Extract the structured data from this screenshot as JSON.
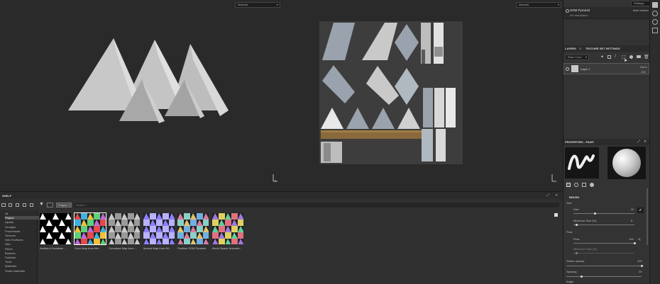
{
  "viewport": {
    "left_mode": "Material",
    "right_mode": "Material",
    "axis_label": "z"
  },
  "top": {
    "settings_label": "Settings"
  },
  "texture_set": {
    "name": "SOM Pyramid",
    "shader": "Main shader",
    "description": "No description"
  },
  "layers": {
    "tab_layers": "LAYERS",
    "tab_settings": "TEXTURE SET SETTINGS",
    "channel": "Base Color",
    "layer_name": "Layer 1",
    "blend_mode": "Norm",
    "opacity": "100"
  },
  "properties": {
    "title": "PROPERTIES - PAINT",
    "brush_header": "BRUSH",
    "size_label": "Size",
    "size_sub": "Size",
    "size_value": "20",
    "min_size_label": "Minimum Size (%)",
    "min_size_value": "5",
    "flow_header": "Flow",
    "flow_label": "Flow",
    "flow_value": "100",
    "min_flow_label": "Minimum Flow (%)",
    "stroke_opacity_label": "Stroke opacity",
    "stroke_opacity_value": "100",
    "spacing_label": "Spacing",
    "spacing_value": "20",
    "angle_label": "Angle",
    "levels": {
      "size": 0.35,
      "min_size": 0.05,
      "flow": 1.0,
      "min_flow": 0.05,
      "stroke_opacity": 1.0,
      "spacing": 0.2
    }
  },
  "shelf": {
    "title": "SHELF",
    "tab": "Project",
    "search_placeholder": "Search...",
    "categories": [
      "All",
      "Project",
      "Alphas",
      "Grunges",
      "Procedurals",
      "Textures",
      "Hard Surfaces",
      "Skin",
      "Filters",
      "Brushes",
      "Particles",
      "Tools",
      "Materials",
      "Smart materials"
    ],
    "selected_category": "Project",
    "items": [
      {
        "name": "Ambient Occlusion ...",
        "colors": [
          "#ffffff",
          "#000000"
        ]
      },
      {
        "name": "Color Map from Me...",
        "colors": [
          "#e64a4a",
          "#3fb0e0",
          "#f2c13a",
          "#5fd07a",
          "#c06ad8"
        ]
      },
      {
        "name": "Curvature Map from ...",
        "colors": [
          "#c9c9c9",
          "#9a9a9a"
        ]
      },
      {
        "name": "Normal Map from Mi...",
        "colors": [
          "#8a80ff",
          "#b8b2ff"
        ]
      },
      {
        "name": "Position SOM Pyramid",
        "colors": [
          "#d87ca0",
          "#8ad0c6",
          "#e0c070",
          "#70b0e0"
        ]
      },
      {
        "name": "World Space Normals...",
        "colors": [
          "#a078e0",
          "#e0d060",
          "#60d0a0",
          "#e07080"
        ]
      }
    ],
    "selected_item": 1
  }
}
